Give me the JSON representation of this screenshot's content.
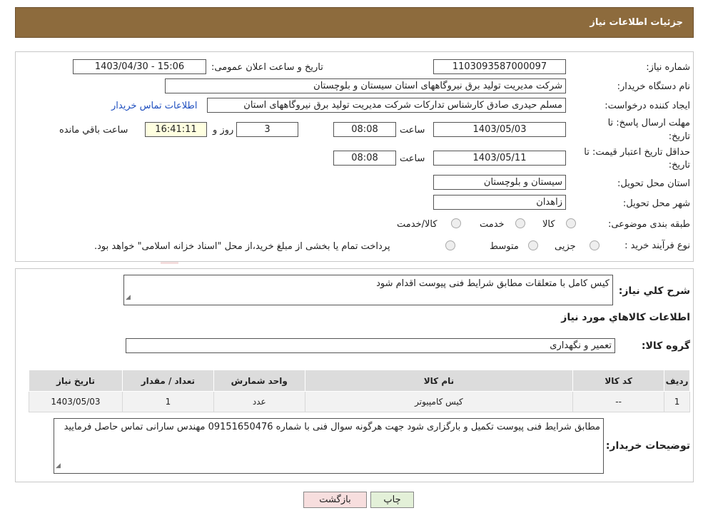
{
  "header": {
    "title": "جزئیات اطلاعات نیاز"
  },
  "form": {
    "need_number_label": "شماره نیاز:",
    "need_number": "1103093587000097",
    "announce_label": "تاریخ و ساعت اعلان عمومی:",
    "announce_value": "1403/04/30 - 15:06",
    "buyer_org_label": "نام دستگاه خریدار:",
    "buyer_org": "شرکت مدیریت تولید برق نیروگاههای استان سیستان و بلوچستان",
    "creator_label": "ایجاد کننده درخواست:",
    "creator": "مسلم حیدری صادق کارشناس تدارکات شرکت مدیریت تولید برق نیروگاههای استان",
    "contact_link": "اطلاعات تماس خریدار",
    "deadline_label_line1": "مهلت ارسال پاسخ: تا",
    "deadline_label_line2": "تاریخ:",
    "deadline_date": "1403/05/03",
    "time_label": "ساعت",
    "deadline_time": "08:08",
    "days_value": "3",
    "days_label": "روز و",
    "remaining_time": "16:41:11",
    "remaining_label": "ساعت باقي مانده",
    "validity_label_line1": "حداقل تاریخ اعتبار قیمت: تا",
    "validity_label_line2": "تاریخ:",
    "validity_date": "1403/05/11",
    "validity_time": "08:08",
    "province_label": "استان محل تحویل:",
    "province": "سیستان و بلوچستان",
    "city_label": "شهر محل تحویل:",
    "city": "زاهدان",
    "category_label": "طبقه بندی موضوعی:",
    "category_options": [
      "کالا",
      "خدمت",
      "کالا/خدمت"
    ],
    "process_label": "نوع فرآیند خرید :",
    "process_options": [
      "جزیی",
      "متوسط"
    ],
    "payment_note": "پرداخت تمام یا بخشی از مبلغ خرید،از محل \"اسناد خزانه اسلامی\" خواهد بود."
  },
  "details": {
    "summary_label": "شرح کلي نياز:",
    "summary": "کیس کامل با متعلقات مطابق شرایط فنی پیوست اقدام شود",
    "goods_info_title": "اطلاعات کالاهاي مورد نياز",
    "goods_group_label": "گروه کالا:",
    "goods_group": "تعمیر و نگهداری",
    "table": {
      "headers": [
        "ردیف",
        "کد کالا",
        "نام کالا",
        "واحد شمارش",
        "تعداد / مقدار",
        "تاریخ نیاز"
      ],
      "rows": [
        [
          "1",
          "--",
          "کیس کامپیوتر",
          "عدد",
          "1",
          "1403/05/03"
        ]
      ]
    },
    "buyer_notes_label": "توضیحات خریدار:",
    "buyer_notes": "مطابق شرایط فنی پیوست تکمیل و بارگزاری شود  جهت هرگونه سوال فنی با شماره  09151650476 مهندس سارانی تماس حاصل فرمایید"
  },
  "buttons": {
    "print": "چاپ",
    "back": "بازگشت"
  },
  "watermark": {
    "text": "AriaTender.neT"
  },
  "colors": {
    "header_bg": "#8d6b3d",
    "link": "#1f4fbf",
    "back_button_bg": "#f7dede",
    "print_button_bg": "#e3f0d8"
  }
}
